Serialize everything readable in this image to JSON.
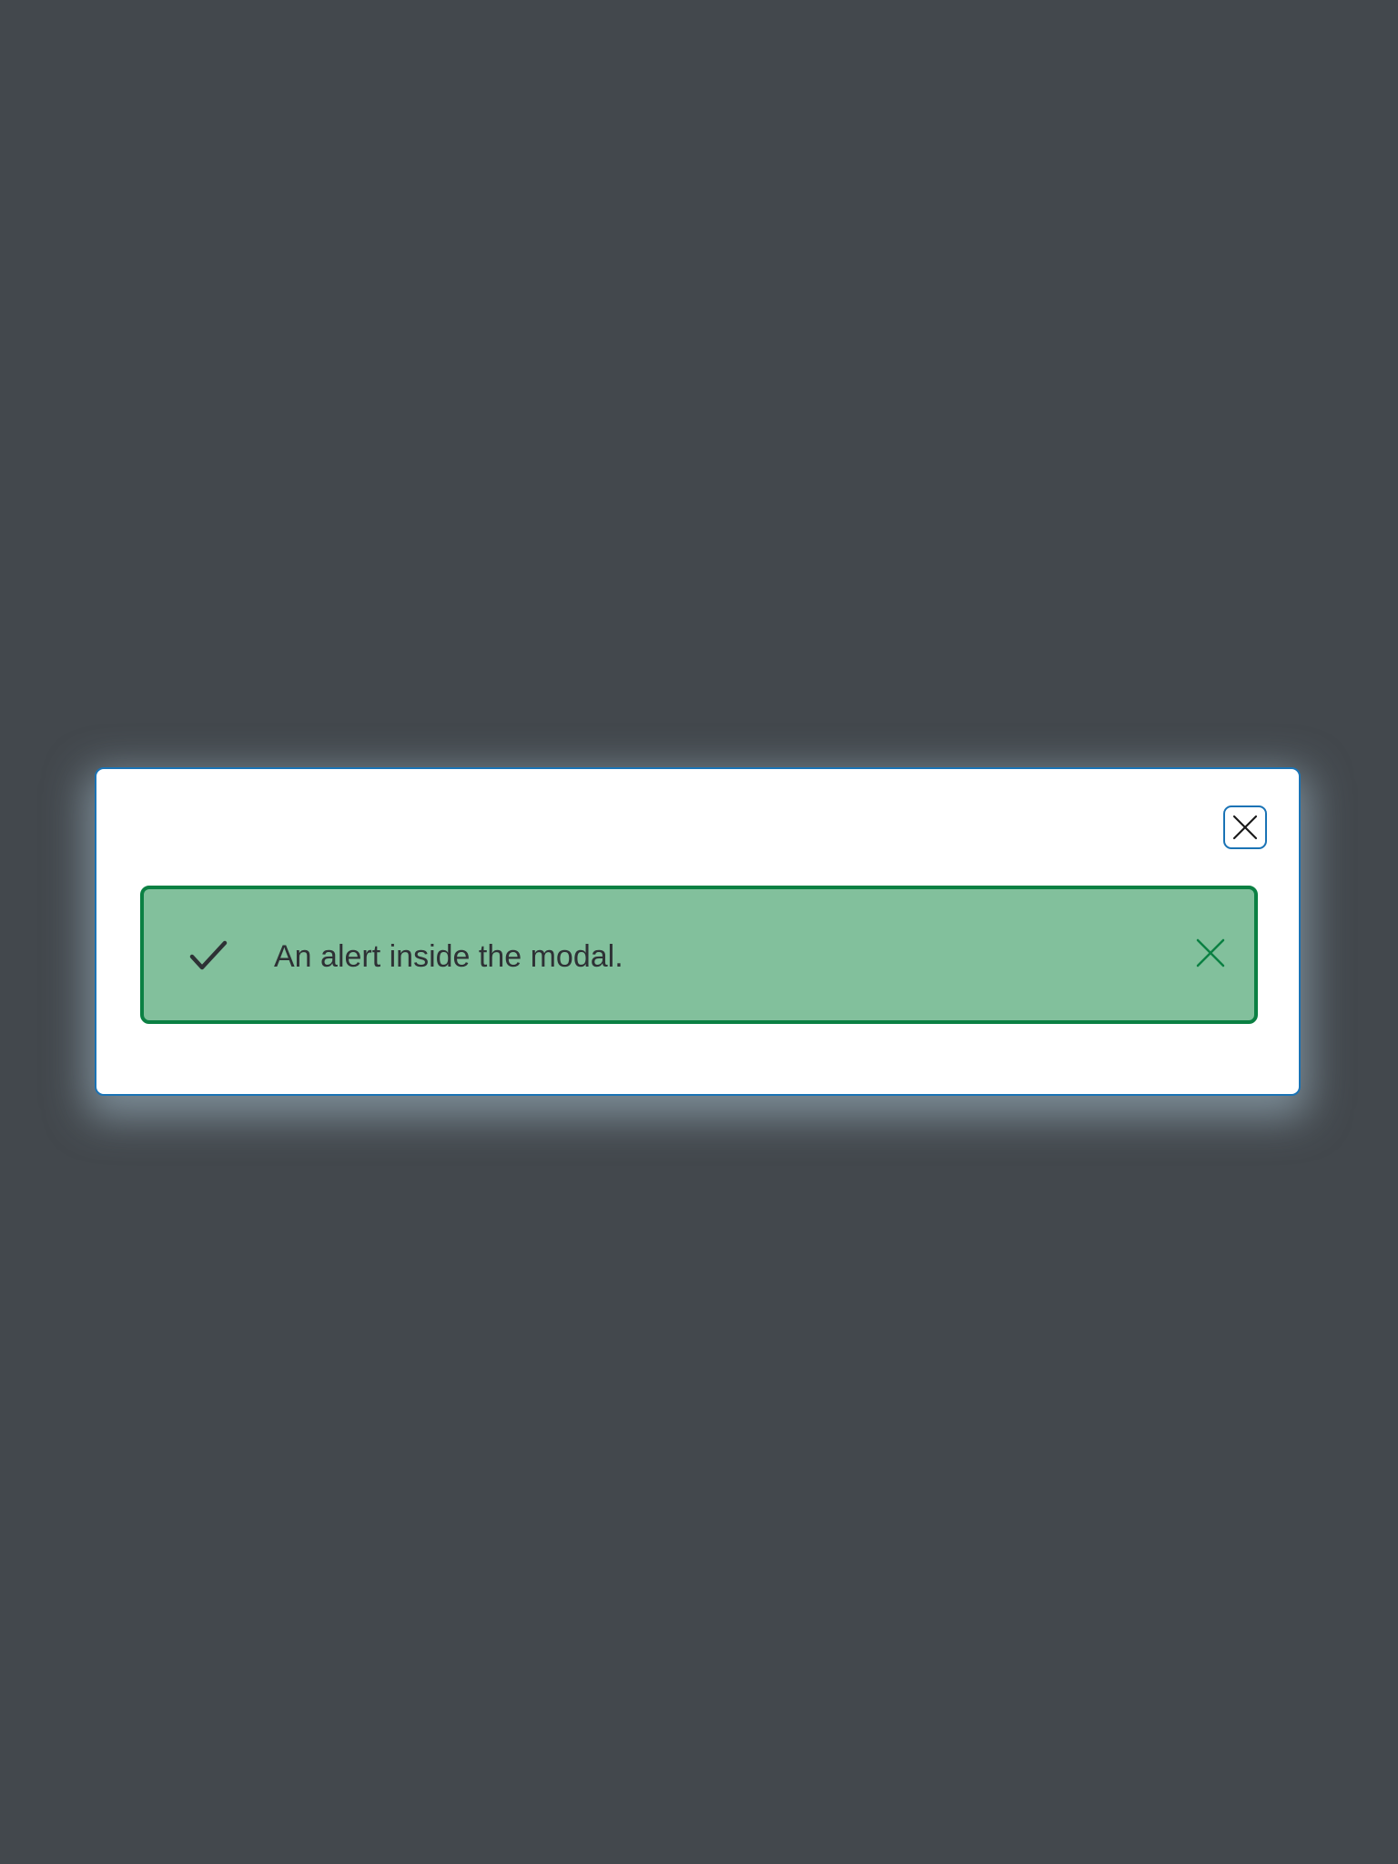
{
  "modal": {
    "close_icon": "close-icon",
    "border_color": "#1a73b5",
    "alert": {
      "text": "An alert inside the modal.",
      "status_icon": "checkmark-icon",
      "close_icon": "close-icon",
      "background_color": "#82c09c",
      "border_color": "#0b8043"
    }
  },
  "backdrop_color": "#43484d"
}
